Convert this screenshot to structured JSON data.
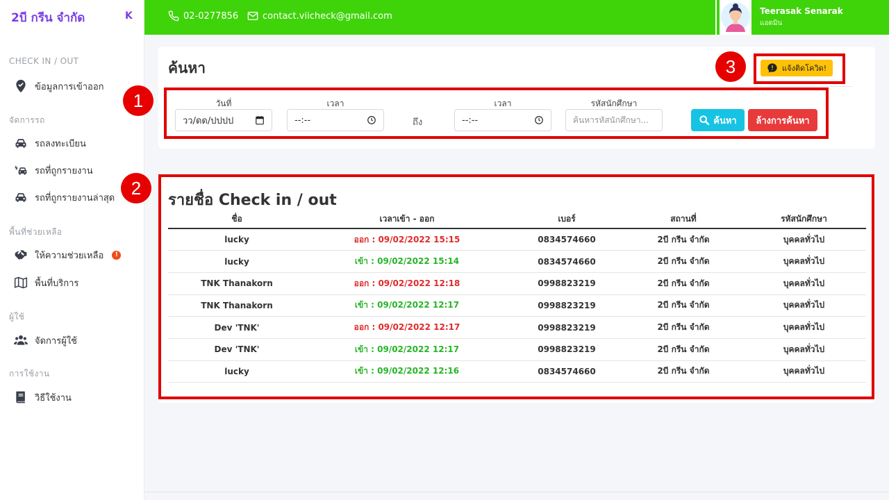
{
  "brand": {
    "title": "2บี กรีน จำกัด",
    "collapse_glyph": "K"
  },
  "sidebar": {
    "sections": [
      {
        "title": "CHECK IN / OUT"
      },
      {
        "title": "จัดการรถ"
      },
      {
        "title": "พื้นที่ช่วยเหลือ"
      },
      {
        "title": "ผู้ใช้"
      },
      {
        "title": "การใช้งาน"
      }
    ],
    "items": [
      {
        "label": "ข้อมูลการเข้าออก",
        "icon": "map-pin-icon"
      },
      {
        "label": "รถลงทะเบียน",
        "icon": "car-icon"
      },
      {
        "label": "รถที่ถูกรายงาน",
        "icon": "car-crash-icon"
      },
      {
        "label": "รถที่ถูกรายงานล่าสุด",
        "icon": "car-icon"
      },
      {
        "label": "ให้ความช่วยเหลือ",
        "icon": "hands-helping-icon",
        "alert": "!"
      },
      {
        "label": "พื้นที่บริการ",
        "icon": "map-icon"
      },
      {
        "label": "จัดการผู้ใช้",
        "icon": "users-icon"
      },
      {
        "label": "วิธีใช้งาน",
        "icon": "book-icon"
      }
    ]
  },
  "topbar": {
    "phone": "02-0277856",
    "email": "contact.viicheck@gmail.com",
    "user_name": "Teerasak Senarak",
    "user_role": "แอดมิน"
  },
  "search": {
    "title": "ค้นหา",
    "covid_button": "แจ้งติดโควิด!",
    "date_label": "วันที่",
    "date_value": "วว/ดด/ปปปป",
    "time_from_label": "เวลา",
    "time_from_value": "--:--",
    "to_label": "ถึง",
    "time_to_label": "เวลา",
    "time_to_value": "--:--",
    "student_label": "รหัสนักศึกษา",
    "student_placeholder": "ค้นหารหัสนักศึกษา...",
    "search_button": "ค้นหา",
    "clear_button": "ล้างการค้นหา"
  },
  "list": {
    "title": "รายชื่อ Check in / out",
    "columns": [
      "ชื่อ",
      "เวลาเข้า - ออก",
      "เบอร์",
      "สถานที่",
      "รหัสนักศึกษา"
    ],
    "rows": [
      {
        "name": "lucky",
        "status": "out",
        "time": "ออก : 09/02/2022 15:15",
        "phone": "0834574660",
        "place": "2บี กรีน จำกัด",
        "student": "บุคคลทั่วไป"
      },
      {
        "name": "lucky",
        "status": "in",
        "time": "เข้า : 09/02/2022 15:14",
        "phone": "0834574660",
        "place": "2บี กรีน จำกัด",
        "student": "บุคคลทั่วไป"
      },
      {
        "name": "TNK Thanakorn",
        "status": "out",
        "time": "ออก : 09/02/2022 12:18",
        "phone": "0998823219",
        "place": "2บี กรีน จำกัด",
        "student": "บุคคลทั่วไป"
      },
      {
        "name": "TNK Thanakorn",
        "status": "in",
        "time": "เข้า : 09/02/2022 12:17",
        "phone": "0998823219",
        "place": "2บี กรีน จำกัด",
        "student": "บุคคลทั่วไป"
      },
      {
        "name": "Dev 'TNK'",
        "status": "out",
        "time": "ออก : 09/02/2022 12:17",
        "phone": "0998823219",
        "place": "2บี กรีน จำกัด",
        "student": "บุคคลทั่วไป"
      },
      {
        "name": "Dev 'TNK'",
        "status": "in",
        "time": "เข้า : 09/02/2022 12:17",
        "phone": "0998823219",
        "place": "2บี กรีน จำกัด",
        "student": "บุคคลทั่วไป"
      },
      {
        "name": "lucky",
        "status": "in",
        "time": "เข้า : 09/02/2022 12:16",
        "phone": "0834574660",
        "place": "2บี กรีน จำกัด",
        "student": "บุคคลทั่วไป"
      }
    ]
  },
  "annotations": [
    "1",
    "2",
    "3"
  ],
  "colors": {
    "topbar": "#3fd30a",
    "brand": "#7b3fe4",
    "annotation": "#e00000",
    "out": "#e02a2a",
    "in": "#26b526"
  }
}
